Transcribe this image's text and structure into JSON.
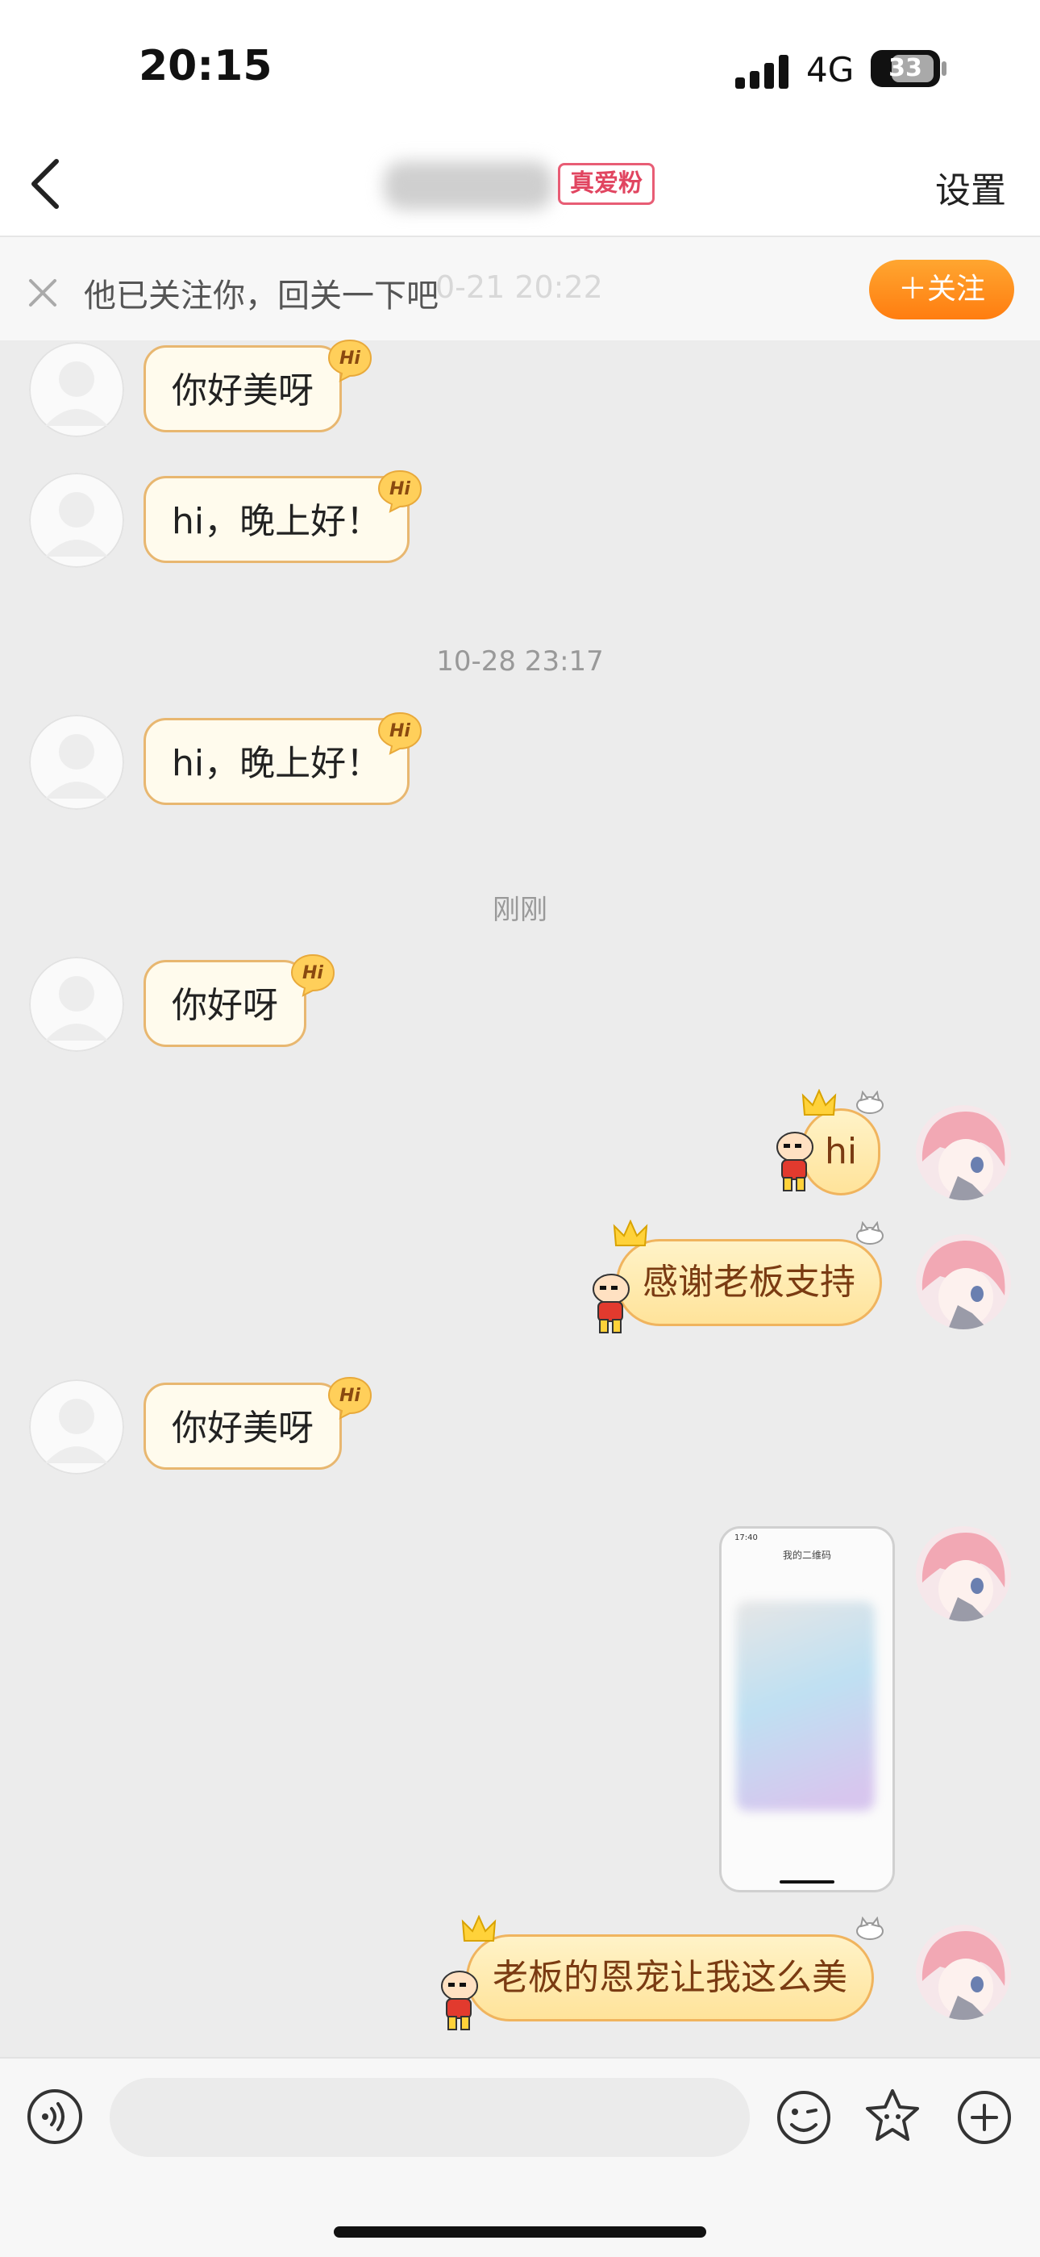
{
  "status_bar": {
    "time": "20:15",
    "network": "4G",
    "battery": "33"
  },
  "nav": {
    "badge": "真爱粉",
    "settings_label": "设置"
  },
  "banner": {
    "text": "他已关注你，回关一下吧",
    "faded_timestamp": "0-21 20:22",
    "follow_label": "＋关注"
  },
  "messages": [
    {
      "side": "left",
      "text": "你好美呀"
    },
    {
      "side": "left",
      "text": "hi，晚上好！"
    },
    {
      "type": "timestamp",
      "text": "10-28 23:17"
    },
    {
      "side": "left",
      "text": "hi，晚上好！"
    },
    {
      "type": "timestamp",
      "text": "刚刚"
    },
    {
      "side": "left",
      "text": "你好呀"
    },
    {
      "side": "right",
      "text": "hi"
    },
    {
      "side": "right",
      "text": "感谢老板支持"
    },
    {
      "side": "left",
      "text": "你好美呀"
    },
    {
      "side": "right",
      "type": "image",
      "thumb_title": "我的二维码",
      "thumb_time": "17:40"
    },
    {
      "side": "right",
      "text": "老板的恩宠让我这么美"
    }
  ],
  "hi_badge": "Hi",
  "colors": {
    "accent_orange": "#ff8a1c",
    "badge_red": "#e14560",
    "bubble_border": "#e8b770"
  },
  "icons": [
    "back-icon",
    "close-icon",
    "voice-icon",
    "emoji-icon",
    "sticker-icon",
    "plus-icon"
  ]
}
